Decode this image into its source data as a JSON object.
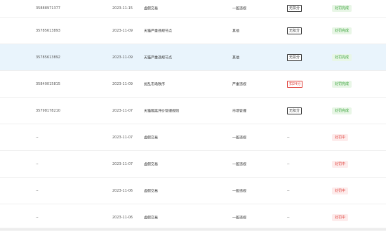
{
  "rows": [
    {
      "id": "35888971377",
      "date": "2023-11-15",
      "reason": "虚假交易",
      "type": "一般违规",
      "score": "无扣分",
      "score_red": false,
      "status": "处罚完成",
      "status_kind": "done"
    },
    {
      "id": "35785613893",
      "date": "2023-11-09",
      "reason": "天猫严重违规节点",
      "type": "其他",
      "score": "无扣分",
      "score_red": false,
      "status": "处罚完成",
      "status_kind": "done"
    },
    {
      "id": "35785613892",
      "date": "2023-11-09",
      "reason": "天猫严重违规节点",
      "type": "其他",
      "score": "无扣分",
      "score_red": false,
      "status": "处罚完成",
      "status_kind": "done"
    },
    {
      "id": "35840015815",
      "date": "2023-11-09",
      "reason": "扰乱市场秩序",
      "type": "严重违规",
      "score": "扣24分",
      "score_red": true,
      "status": "处罚完成",
      "status_kind": "done"
    },
    {
      "id": "35798178210",
      "date": "2023-11-07",
      "reason": "天猫隔离评价管理规则",
      "type": "市场管理",
      "score": "无扣分",
      "score_red": false,
      "status": "处罚完成",
      "status_kind": "done"
    },
    {
      "id": "--",
      "date": "2023-11-07",
      "reason": "虚假交易",
      "type": "一般违规",
      "score": "--",
      "score_red": false,
      "status": "处罚中",
      "status_kind": "proc"
    },
    {
      "id": "--",
      "date": "2023-11-07",
      "reason": "虚假交易",
      "type": "一般违规",
      "score": "--",
      "score_red": false,
      "status": "处罚中",
      "status_kind": "proc"
    },
    {
      "id": "--",
      "date": "2023-11-06",
      "reason": "虚假交易",
      "type": "一般违规",
      "score": "--",
      "score_red": false,
      "status": "处罚中",
      "status_kind": "proc"
    },
    {
      "id": "--",
      "date": "2023-11-06",
      "reason": "虚假交易",
      "type": "一般违规",
      "score": "--",
      "score_red": false,
      "status": "处罚中",
      "status_kind": "proc"
    }
  ],
  "highlighted_row": 2,
  "colors": {
    "highlight": "#e9f4fc",
    "done_bg": "#e8f6e6",
    "done_text": "#3aa33a",
    "proc_bg": "#fdecec",
    "proc_text": "#e0403a"
  }
}
